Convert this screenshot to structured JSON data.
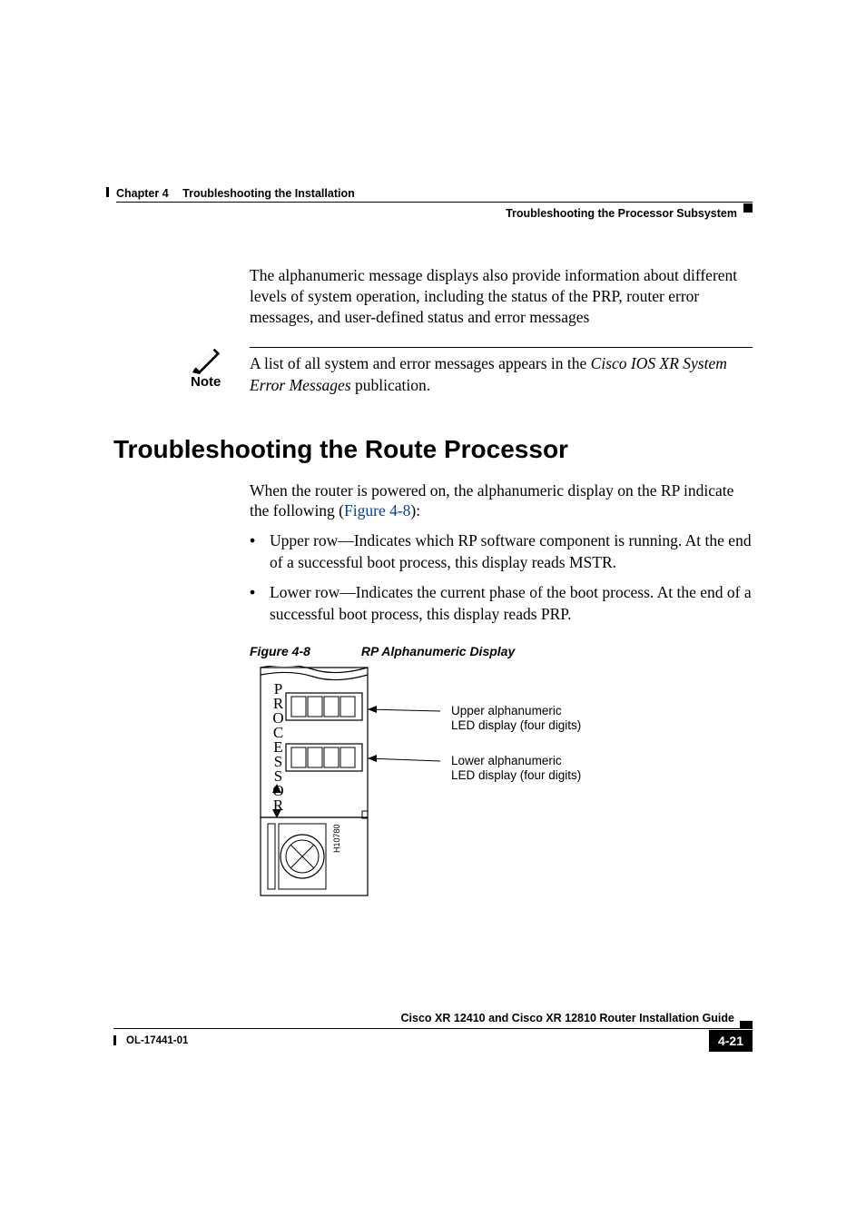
{
  "header": {
    "chapter_label": "Chapter 4",
    "chapter_title": "Troubleshooting the Installation",
    "section": "Troubleshooting the Processor Subsystem"
  },
  "paragraphs": {
    "intro": "The alphanumeric message displays also provide information about different levels of system operation, including the status of the PRP, router error messages, and user-defined status and error messages"
  },
  "note": {
    "label": "Note",
    "text_prefix": "A list of all system and error messages appears in the ",
    "text_italic": "Cisco IOS XR System Error Messages",
    "text_suffix": " publication."
  },
  "heading": "Troubleshooting the Route Processor",
  "body2": {
    "prefix": "When the router is powered on, the alphanumeric display on the RP indicate the following (",
    "link": "Figure 4-8",
    "suffix": "):"
  },
  "bullets": [
    "Upper row—Indicates which RP software component is running. At the end of a successful boot process, this display reads MSTR.",
    "Lower row—Indicates the current phase of the boot process. At the end of a successful boot process, this display reads PRP."
  ],
  "figure": {
    "label": "Figure 4-8",
    "title": "RP Alphanumeric Display",
    "side_label": "PROCESSOR",
    "art_id": "H10780",
    "callout_upper_l1": "Upper alphanumeric",
    "callout_upper_l2": "LED display (four digits)",
    "callout_lower_l1": "Lower alphanumeric",
    "callout_lower_l2": "LED display (four digits)"
  },
  "footer": {
    "guide_title": "Cisco XR 12410 and Cisco XR 12810 Router Installation Guide",
    "doc_id": "OL-17441-01",
    "page_num": "4-21"
  }
}
